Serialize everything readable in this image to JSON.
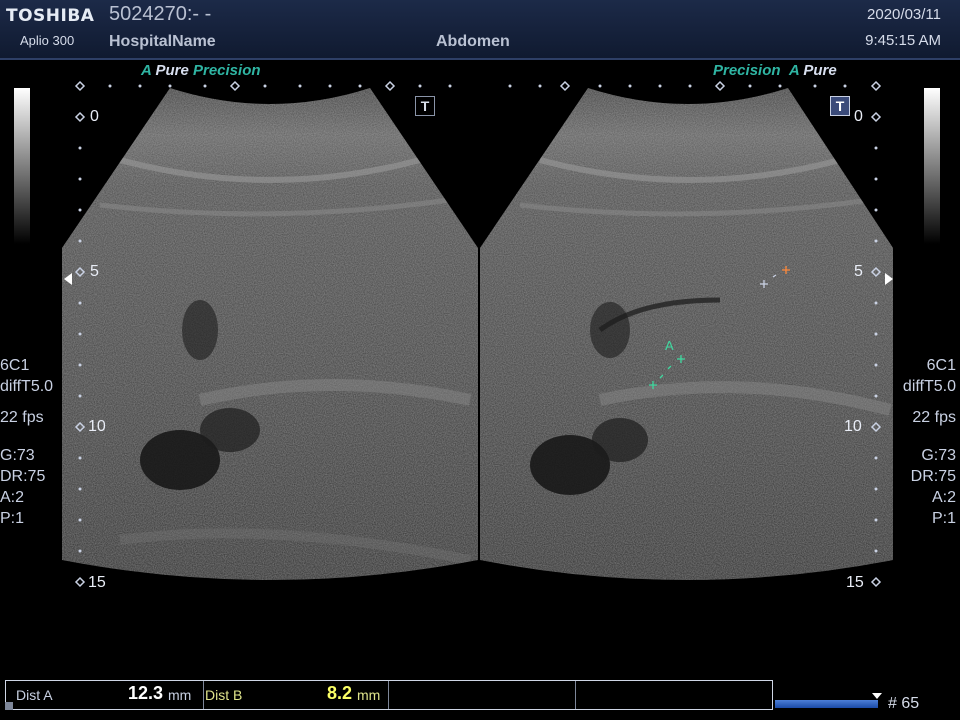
{
  "header": {
    "brand": "TOSHIBA",
    "model": "Aplio 300",
    "patient_id": "5024270:- -",
    "hospital": "HospitalName",
    "exam": "Abdomen",
    "date": "2020/03/11",
    "time": "9:45:15 AM"
  },
  "left_image": {
    "mode_a": "A",
    "mode_pure": "Pure",
    "mode_precision": "Precision",
    "depth_labels": [
      "0",
      "5",
      "10",
      "15"
    ],
    "params": {
      "probe": "6C1",
      "freq": "diffT5.0",
      "fps": "22 fps",
      "gain": "G:73",
      "dr": "DR:75",
      "a": "A:2",
      "p": "P:1"
    },
    "t_badge": "T"
  },
  "right_image": {
    "mode_precision": "Precision",
    "mode_a": "A",
    "mode_pure": "Pure",
    "depth_labels": [
      "0",
      "5",
      "10",
      "15"
    ],
    "params": {
      "probe": "6C1",
      "freq": "diffT5.0",
      "fps": "22 fps",
      "gain": "G:73",
      "dr": "DR:75",
      "a": "A:2",
      "p": "P:1"
    },
    "t_badge": "T",
    "caliper_label": "A"
  },
  "measurements": {
    "dist_a_label": "Dist A",
    "dist_a_value": "12.3",
    "dist_a_unit": "mm",
    "dist_b_label": "Dist B",
    "dist_b_value": "8.2",
    "dist_b_unit": "mm"
  },
  "frame": {
    "count": "# 65"
  },
  "colors": {
    "accent_teal": "#2fb5a3",
    "caliper_green": "#3fd9a0",
    "caliper_orange": "#ff8a3c",
    "dist_b_yellow": "#fbff66"
  }
}
